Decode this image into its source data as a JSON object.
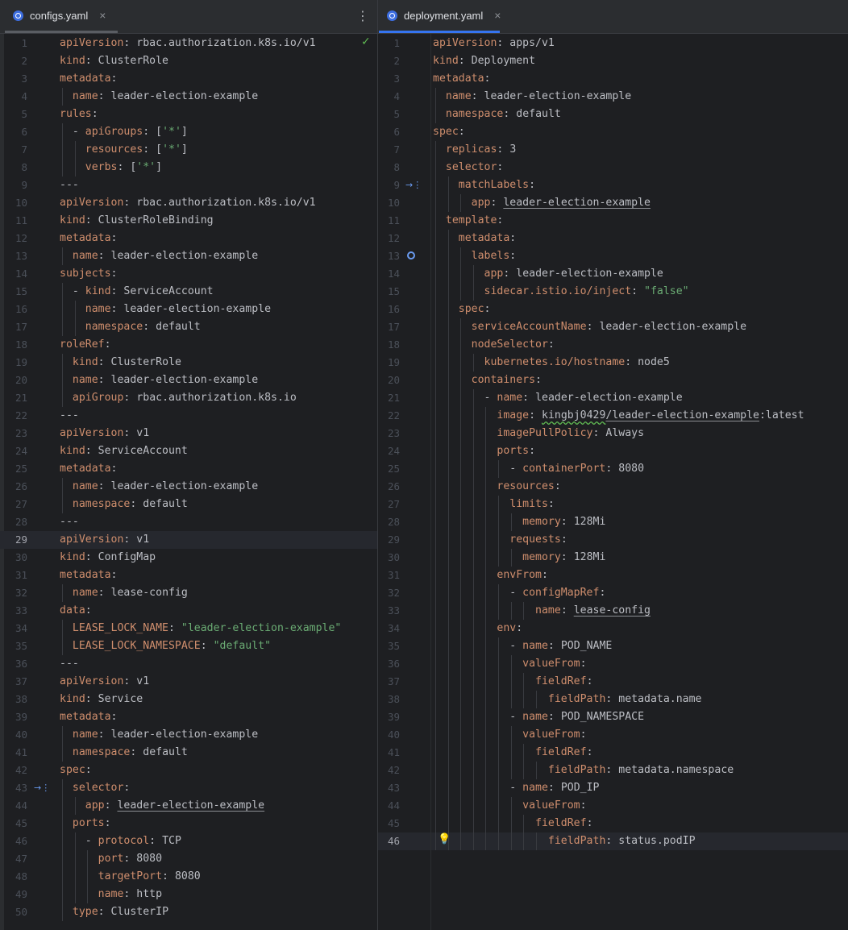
{
  "tabs": {
    "left": {
      "name": "configs.yaml",
      "close": "×",
      "more": "⋮"
    },
    "right": {
      "name": "deployment.yaml",
      "close": "×"
    }
  },
  "colors": {
    "key": "#cf8e6d",
    "value": "#bcbec4",
    "string": "#6aab73",
    "accent": "#3574f0",
    "background": "#1e1f22"
  },
  "left": {
    "current_line": 29,
    "lines": [
      [
        [
          "k",
          "apiVersion"
        ],
        [
          "p",
          ": "
        ],
        [
          "v",
          "rbac.authorization.k8s.io/v1"
        ]
      ],
      [
        [
          "k",
          "kind"
        ],
        [
          "p",
          ": "
        ],
        [
          "v",
          "ClusterRole"
        ]
      ],
      [
        [
          "k",
          "metadata"
        ],
        [
          "p",
          ":"
        ]
      ],
      [
        [
          "v",
          "  "
        ],
        [
          "k",
          "name"
        ],
        [
          "p",
          ": "
        ],
        [
          "v",
          "leader-election-example"
        ]
      ],
      [
        [
          "k",
          "rules"
        ],
        [
          "p",
          ":"
        ]
      ],
      [
        [
          "v",
          "  - "
        ],
        [
          "k",
          "apiGroups"
        ],
        [
          "p",
          ": ["
        ],
        [
          "s",
          "'*'"
        ],
        [
          "p",
          "]"
        ]
      ],
      [
        [
          "v",
          "    "
        ],
        [
          "k",
          "resources"
        ],
        [
          "p",
          ": ["
        ],
        [
          "s",
          "'*'"
        ],
        [
          "p",
          "]"
        ]
      ],
      [
        [
          "v",
          "    "
        ],
        [
          "k",
          "verbs"
        ],
        [
          "p",
          ": ["
        ],
        [
          "s",
          "'*'"
        ],
        [
          "p",
          "]"
        ]
      ],
      [
        [
          "v",
          "---"
        ]
      ],
      [
        [
          "k",
          "apiVersion"
        ],
        [
          "p",
          ": "
        ],
        [
          "v",
          "rbac.authorization.k8s.io/v1"
        ]
      ],
      [
        [
          "k",
          "kind"
        ],
        [
          "p",
          ": "
        ],
        [
          "v",
          "ClusterRoleBinding"
        ]
      ],
      [
        [
          "k",
          "metadata"
        ],
        [
          "p",
          ":"
        ]
      ],
      [
        [
          "v",
          "  "
        ],
        [
          "k",
          "name"
        ],
        [
          "p",
          ": "
        ],
        [
          "v",
          "leader-election-example"
        ]
      ],
      [
        [
          "k",
          "subjects"
        ],
        [
          "p",
          ":"
        ]
      ],
      [
        [
          "v",
          "  - "
        ],
        [
          "k",
          "kind"
        ],
        [
          "p",
          ": "
        ],
        [
          "v",
          "ServiceAccount"
        ]
      ],
      [
        [
          "v",
          "    "
        ],
        [
          "k",
          "name"
        ],
        [
          "p",
          ": "
        ],
        [
          "v",
          "leader-election-example"
        ]
      ],
      [
        [
          "v",
          "    "
        ],
        [
          "k",
          "namespace"
        ],
        [
          "p",
          ": "
        ],
        [
          "v",
          "default"
        ]
      ],
      [
        [
          "k",
          "roleRef"
        ],
        [
          "p",
          ":"
        ]
      ],
      [
        [
          "v",
          "  "
        ],
        [
          "k",
          "kind"
        ],
        [
          "p",
          ": "
        ],
        [
          "v",
          "ClusterRole"
        ]
      ],
      [
        [
          "v",
          "  "
        ],
        [
          "k",
          "name"
        ],
        [
          "p",
          ": "
        ],
        [
          "v",
          "leader-election-example"
        ]
      ],
      [
        [
          "v",
          "  "
        ],
        [
          "k",
          "apiGroup"
        ],
        [
          "p",
          ": "
        ],
        [
          "v",
          "rbac.authorization.k8s.io"
        ]
      ],
      [
        [
          "v",
          "---"
        ]
      ],
      [
        [
          "k",
          "apiVersion"
        ],
        [
          "p",
          ": "
        ],
        [
          "v",
          "v1"
        ]
      ],
      [
        [
          "k",
          "kind"
        ],
        [
          "p",
          ": "
        ],
        [
          "v",
          "ServiceAccount"
        ]
      ],
      [
        [
          "k",
          "metadata"
        ],
        [
          "p",
          ":"
        ]
      ],
      [
        [
          "v",
          "  "
        ],
        [
          "k",
          "name"
        ],
        [
          "p",
          ": "
        ],
        [
          "v",
          "leader-election-example"
        ]
      ],
      [
        [
          "v",
          "  "
        ],
        [
          "k",
          "namespace"
        ],
        [
          "p",
          ": "
        ],
        [
          "v",
          "default"
        ]
      ],
      [
        [
          "v",
          "---"
        ]
      ],
      [
        [
          "k",
          "apiVersion"
        ],
        [
          "p",
          ": "
        ],
        [
          "v",
          "v1"
        ]
      ],
      [
        [
          "k",
          "kind"
        ],
        [
          "p",
          ": "
        ],
        [
          "v",
          "ConfigMap"
        ]
      ],
      [
        [
          "k",
          "metadata"
        ],
        [
          "p",
          ":"
        ]
      ],
      [
        [
          "v",
          "  "
        ],
        [
          "k",
          "name"
        ],
        [
          "p",
          ": "
        ],
        [
          "v",
          "lease-config"
        ]
      ],
      [
        [
          "k",
          "data"
        ],
        [
          "p",
          ":"
        ]
      ],
      [
        [
          "v",
          "  "
        ],
        [
          "k",
          "LEASE_LOCK_NAME"
        ],
        [
          "p",
          ": "
        ],
        [
          "s",
          "\"leader-election-example\""
        ]
      ],
      [
        [
          "v",
          "  "
        ],
        [
          "k",
          "LEASE_LOCK_NAMESPACE"
        ],
        [
          "p",
          ": "
        ],
        [
          "s",
          "\"default\""
        ]
      ],
      [
        [
          "v",
          "---"
        ]
      ],
      [
        [
          "k",
          "apiVersion"
        ],
        [
          "p",
          ": "
        ],
        [
          "v",
          "v1"
        ]
      ],
      [
        [
          "k",
          "kind"
        ],
        [
          "p",
          ": "
        ],
        [
          "v",
          "Service"
        ]
      ],
      [
        [
          "k",
          "metadata"
        ],
        [
          "p",
          ":"
        ]
      ],
      [
        [
          "v",
          "  "
        ],
        [
          "k",
          "name"
        ],
        [
          "p",
          ": "
        ],
        [
          "v",
          "leader-election-example"
        ]
      ],
      [
        [
          "v",
          "  "
        ],
        [
          "k",
          "namespace"
        ],
        [
          "p",
          ": "
        ],
        [
          "v",
          "default"
        ]
      ],
      [
        [
          "k",
          "spec"
        ],
        [
          "p",
          ":"
        ]
      ],
      [
        [
          "v",
          "  "
        ],
        [
          "k",
          "selector"
        ],
        [
          "p",
          ":"
        ]
      ],
      [
        [
          "v",
          "    "
        ],
        [
          "k",
          "app"
        ],
        [
          "p",
          ": "
        ],
        [
          "u",
          "leader-election-example"
        ]
      ],
      [
        [
          "v",
          "  "
        ],
        [
          "k",
          "ports"
        ],
        [
          "p",
          ":"
        ]
      ],
      [
        [
          "v",
          "    - "
        ],
        [
          "k",
          "protocol"
        ],
        [
          "p",
          ": "
        ],
        [
          "v",
          "TCP"
        ]
      ],
      [
        [
          "v",
          "      "
        ],
        [
          "k",
          "port"
        ],
        [
          "p",
          ": "
        ],
        [
          "v",
          "8080"
        ]
      ],
      [
        [
          "v",
          "      "
        ],
        [
          "k",
          "targetPort"
        ],
        [
          "p",
          ": "
        ],
        [
          "v",
          "8080"
        ]
      ],
      [
        [
          "v",
          "      "
        ],
        [
          "k",
          "name"
        ],
        [
          "p",
          ": "
        ],
        [
          "v",
          "http"
        ]
      ],
      [
        [
          "v",
          "  "
        ],
        [
          "k",
          "type"
        ],
        [
          "p",
          ": "
        ],
        [
          "v",
          "ClusterIP"
        ]
      ]
    ],
    "gutter_icons": {
      "1": "check",
      "43": "implementation"
    }
  },
  "right": {
    "current_line": 46,
    "lines": [
      [
        [
          "k",
          "apiVersion"
        ],
        [
          "p",
          ": "
        ],
        [
          "v",
          "apps/v1"
        ]
      ],
      [
        [
          "k",
          "kind"
        ],
        [
          "p",
          ": "
        ],
        [
          "v",
          "Deployment"
        ]
      ],
      [
        [
          "k",
          "metadata"
        ],
        [
          "p",
          ":"
        ]
      ],
      [
        [
          "v",
          "  "
        ],
        [
          "k",
          "name"
        ],
        [
          "p",
          ": "
        ],
        [
          "v",
          "leader-election-example"
        ]
      ],
      [
        [
          "v",
          "  "
        ],
        [
          "k",
          "namespace"
        ],
        [
          "p",
          ": "
        ],
        [
          "v",
          "default"
        ]
      ],
      [
        [
          "k",
          "spec"
        ],
        [
          "p",
          ":"
        ]
      ],
      [
        [
          "v",
          "  "
        ],
        [
          "k",
          "replicas"
        ],
        [
          "p",
          ": "
        ],
        [
          "v",
          "3"
        ]
      ],
      [
        [
          "v",
          "  "
        ],
        [
          "k",
          "selector"
        ],
        [
          "p",
          ":"
        ]
      ],
      [
        [
          "v",
          "    "
        ],
        [
          "k",
          "matchLabels"
        ],
        [
          "p",
          ":"
        ]
      ],
      [
        [
          "v",
          "      "
        ],
        [
          "k",
          "app"
        ],
        [
          "p",
          ": "
        ],
        [
          "u",
          "leader-election-example"
        ]
      ],
      [
        [
          "v",
          "  "
        ],
        [
          "k",
          "template"
        ],
        [
          "p",
          ":"
        ]
      ],
      [
        [
          "v",
          "    "
        ],
        [
          "k",
          "metadata"
        ],
        [
          "p",
          ":"
        ]
      ],
      [
        [
          "v",
          "      "
        ],
        [
          "k",
          "labels"
        ],
        [
          "p",
          ":"
        ]
      ],
      [
        [
          "v",
          "        "
        ],
        [
          "k",
          "app"
        ],
        [
          "p",
          ": "
        ],
        [
          "v",
          "leader-election-example"
        ]
      ],
      [
        [
          "v",
          "        "
        ],
        [
          "k",
          "sidecar.istio.io/inject"
        ],
        [
          "p",
          ": "
        ],
        [
          "s",
          "\"false\""
        ]
      ],
      [
        [
          "v",
          "    "
        ],
        [
          "k",
          "spec"
        ],
        [
          "p",
          ":"
        ]
      ],
      [
        [
          "v",
          "      "
        ],
        [
          "k",
          "serviceAccountName"
        ],
        [
          "p",
          ": "
        ],
        [
          "v",
          "leader-election-example"
        ]
      ],
      [
        [
          "v",
          "      "
        ],
        [
          "k",
          "nodeSelector"
        ],
        [
          "p",
          ":"
        ]
      ],
      [
        [
          "v",
          "        "
        ],
        [
          "k",
          "kubernetes.io/hostname"
        ],
        [
          "p",
          ": "
        ],
        [
          "v",
          "node5"
        ]
      ],
      [
        [
          "v",
          "      "
        ],
        [
          "k",
          "containers"
        ],
        [
          "p",
          ":"
        ]
      ],
      [
        [
          "v",
          "        - "
        ],
        [
          "k",
          "name"
        ],
        [
          "p",
          ": "
        ],
        [
          "v",
          "leader-election-example"
        ]
      ],
      [
        [
          "v",
          "          "
        ],
        [
          "k",
          "image"
        ],
        [
          "p",
          ": "
        ],
        [
          "w",
          "kingbj0429"
        ],
        [
          "u",
          "/leader-election-example"
        ],
        [
          "v",
          ":latest"
        ]
      ],
      [
        [
          "v",
          "          "
        ],
        [
          "k",
          "imagePullPolicy"
        ],
        [
          "p",
          ": "
        ],
        [
          "v",
          "Always"
        ]
      ],
      [
        [
          "v",
          "          "
        ],
        [
          "k",
          "ports"
        ],
        [
          "p",
          ":"
        ]
      ],
      [
        [
          "v",
          "            - "
        ],
        [
          "k",
          "containerPort"
        ],
        [
          "p",
          ": "
        ],
        [
          "v",
          "8080"
        ]
      ],
      [
        [
          "v",
          "          "
        ],
        [
          "k",
          "resources"
        ],
        [
          "p",
          ":"
        ]
      ],
      [
        [
          "v",
          "            "
        ],
        [
          "k",
          "limits"
        ],
        [
          "p",
          ":"
        ]
      ],
      [
        [
          "v",
          "              "
        ],
        [
          "k",
          "memory"
        ],
        [
          "p",
          ": "
        ],
        [
          "v",
          "128Mi"
        ]
      ],
      [
        [
          "v",
          "            "
        ],
        [
          "k",
          "requests"
        ],
        [
          "p",
          ":"
        ]
      ],
      [
        [
          "v",
          "              "
        ],
        [
          "k",
          "memory"
        ],
        [
          "p",
          ": "
        ],
        [
          "v",
          "128Mi"
        ]
      ],
      [
        [
          "v",
          "          "
        ],
        [
          "k",
          "envFrom"
        ],
        [
          "p",
          ":"
        ]
      ],
      [
        [
          "v",
          "            - "
        ],
        [
          "k",
          "configMapRef"
        ],
        [
          "p",
          ":"
        ]
      ],
      [
        [
          "v",
          "                "
        ],
        [
          "k",
          "name"
        ],
        [
          "p",
          ": "
        ],
        [
          "u",
          "lease-config"
        ]
      ],
      [
        [
          "v",
          "          "
        ],
        [
          "k",
          "env"
        ],
        [
          "p",
          ":"
        ]
      ],
      [
        [
          "v",
          "            - "
        ],
        [
          "k",
          "name"
        ],
        [
          "p",
          ": "
        ],
        [
          "v",
          "POD_NAME"
        ]
      ],
      [
        [
          "v",
          "              "
        ],
        [
          "k",
          "valueFrom"
        ],
        [
          "p",
          ":"
        ]
      ],
      [
        [
          "v",
          "                "
        ],
        [
          "k",
          "fieldRef"
        ],
        [
          "p",
          ":"
        ]
      ],
      [
        [
          "v",
          "                  "
        ],
        [
          "k",
          "fieldPath"
        ],
        [
          "p",
          ": "
        ],
        [
          "v",
          "metadata.name"
        ]
      ],
      [
        [
          "v",
          "            - "
        ],
        [
          "k",
          "name"
        ],
        [
          "p",
          ": "
        ],
        [
          "v",
          "POD_NAMESPACE"
        ]
      ],
      [
        [
          "v",
          "              "
        ],
        [
          "k",
          "valueFrom"
        ],
        [
          "p",
          ":"
        ]
      ],
      [
        [
          "v",
          "                "
        ],
        [
          "k",
          "fieldRef"
        ],
        [
          "p",
          ":"
        ]
      ],
      [
        [
          "v",
          "                  "
        ],
        [
          "k",
          "fieldPath"
        ],
        [
          "p",
          ": "
        ],
        [
          "v",
          "metadata.namespace"
        ]
      ],
      [
        [
          "v",
          "            - "
        ],
        [
          "k",
          "name"
        ],
        [
          "p",
          ": "
        ],
        [
          "v",
          "POD_IP"
        ]
      ],
      [
        [
          "v",
          "              "
        ],
        [
          "k",
          "valueFrom"
        ],
        [
          "p",
          ":"
        ]
      ],
      [
        [
          "v",
          "                "
        ],
        [
          "k",
          "fieldRef"
        ],
        [
          "p",
          ":"
        ]
      ],
      [
        [
          "v",
          "                  "
        ],
        [
          "k",
          "fieldPath"
        ],
        [
          "p",
          ": "
        ],
        [
          "v",
          "status.podIP"
        ]
      ]
    ],
    "gutter_icons": {
      "9": "implementation",
      "13": "run",
      "46": "bulb"
    }
  }
}
